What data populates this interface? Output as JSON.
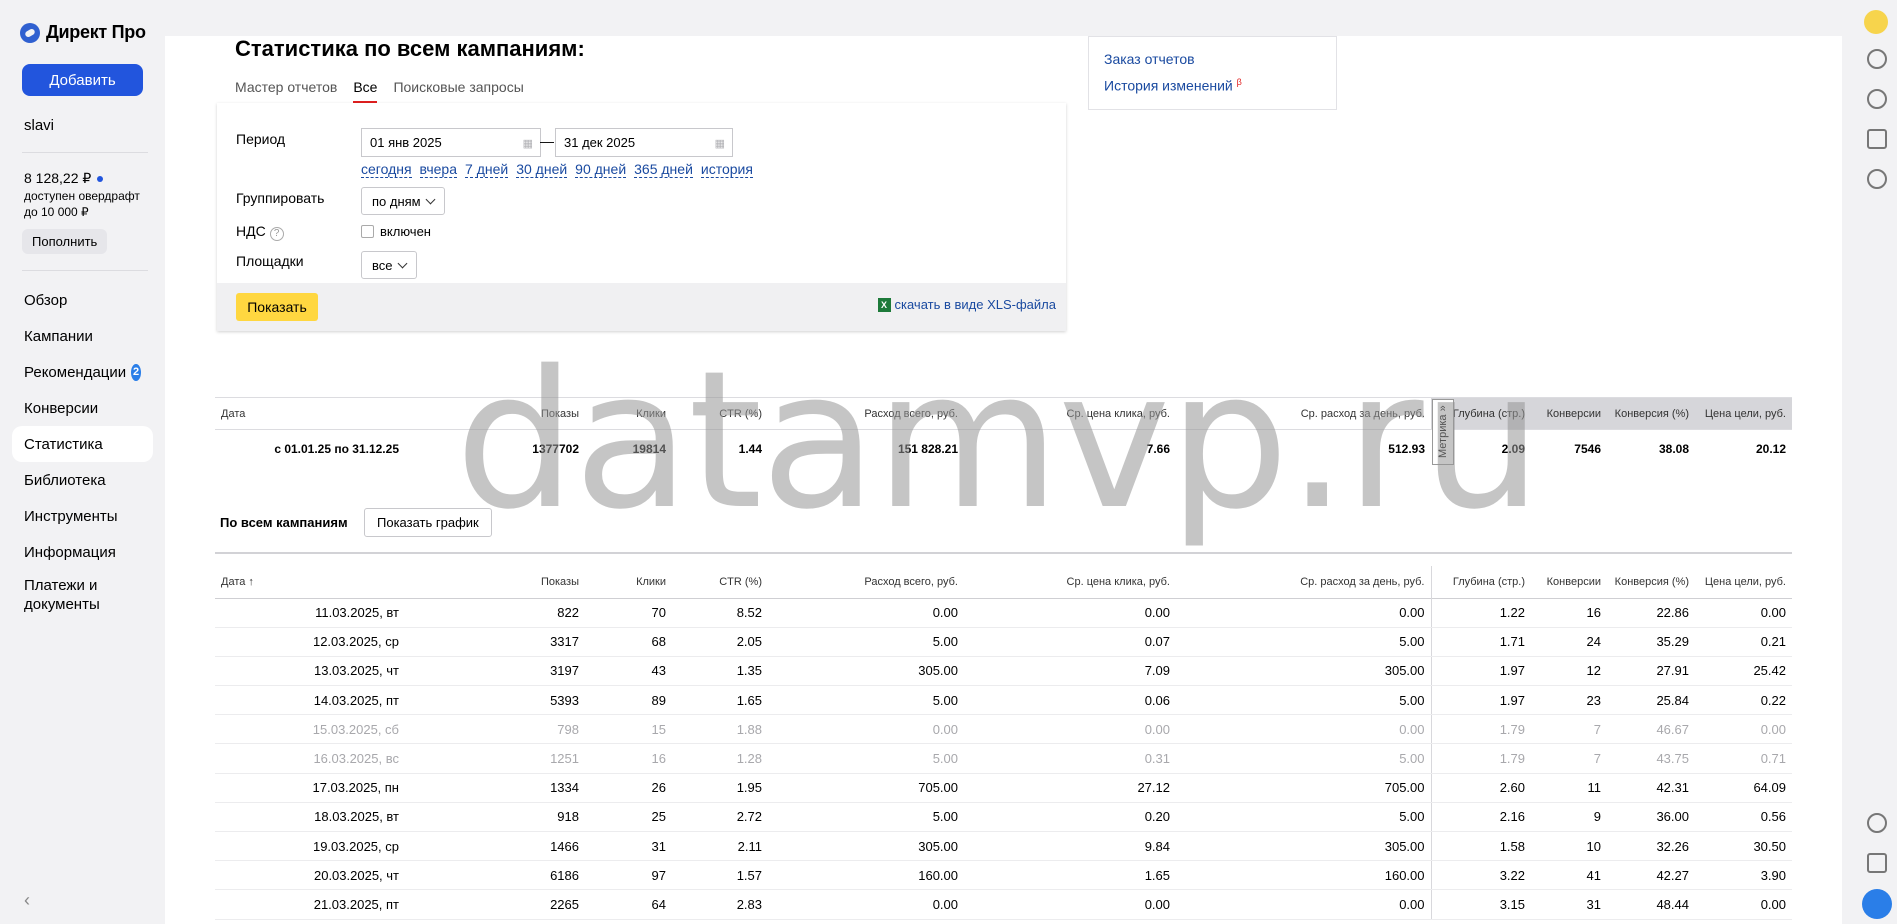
{
  "sidebar": {
    "logo_text": "Директ Про",
    "add_button": "Добавить",
    "user": "slavi",
    "balance": "8 128,22 ₽",
    "overdraft": "доступен овердрафт до 10 000 ₽",
    "topup": "Пополнить",
    "nav": [
      {
        "label": "Обзор"
      },
      {
        "label": "Кампании"
      },
      {
        "label": "Рекомендации",
        "badge": "2"
      },
      {
        "label": "Конверсии"
      },
      {
        "label": "Статистика",
        "active": true
      },
      {
        "label": "Библиотека"
      },
      {
        "label": "Инструменты"
      },
      {
        "label": "Информация"
      },
      {
        "label": "Платежи и документы"
      }
    ]
  },
  "header": {
    "title": "Статистика по всем кампаниям:",
    "tabs": [
      "Мастер отчетов",
      "Все",
      "Поисковые запросы"
    ],
    "active_tab": "Все"
  },
  "report_links": {
    "order": "Заказ отчетов",
    "history": "История изменений",
    "history_mark": "β"
  },
  "filters": {
    "period_label": "Период",
    "date_from": "01 янв 2025",
    "date_to": "31 дек 2025",
    "dash": "—",
    "quick": [
      "сегодня",
      "вчера",
      "7 дней",
      "30 дней",
      "90 дней",
      "365 дней",
      "история"
    ],
    "group_label": "Группировать",
    "group_value": "по дням",
    "vat_label": "НДС",
    "vat_help": "?",
    "vat_check": "включен",
    "places_label": "Площадки",
    "places_value": "все",
    "show_button": "Показать",
    "xls_link": "скачать в виде XLS-файла",
    "xls_icon": "X"
  },
  "columns": [
    "Дата",
    "Показы",
    "Клики",
    "CTR (%)",
    "Расход всего, руб.",
    "Ср. цена клика, руб.",
    "Ср. расход за день, руб.",
    "Глубина (стр.)",
    "Конверсии",
    "Конверсия (%)",
    "Цена цели, руб."
  ],
  "daily_date_header": "Дата ↑",
  "summary": {
    "metrika": "Метрика »",
    "row": [
      "с 01.01.25 по 31.12.25",
      "1377702",
      "19814",
      "1.44",
      "151 828.21",
      "7.66",
      "512.93",
      "2.09",
      "7546",
      "38.08",
      "20.12"
    ]
  },
  "subsection": {
    "title": "По всем кампаниям",
    "graph_button": "Показать график"
  },
  "daily_rows": [
    {
      "cells": [
        "11.03.2025, вт",
        "822",
        "70",
        "8.52",
        "0.00",
        "0.00",
        "0.00",
        "1.22",
        "16",
        "22.86",
        "0.00"
      ]
    },
    {
      "cells": [
        "12.03.2025, ср",
        "3317",
        "68",
        "2.05",
        "5.00",
        "0.07",
        "5.00",
        "1.71",
        "24",
        "35.29",
        "0.21"
      ]
    },
    {
      "cells": [
        "13.03.2025, чт",
        "3197",
        "43",
        "1.35",
        "305.00",
        "7.09",
        "305.00",
        "1.97",
        "12",
        "27.91",
        "25.42"
      ]
    },
    {
      "cells": [
        "14.03.2025, пт",
        "5393",
        "89",
        "1.65",
        "5.00",
        "0.06",
        "5.00",
        "1.97",
        "23",
        "25.84",
        "0.22"
      ]
    },
    {
      "cells": [
        "15.03.2025, сб",
        "798",
        "15",
        "1.88",
        "0.00",
        "0.00",
        "0.00",
        "1.79",
        "7",
        "46.67",
        "0.00"
      ],
      "weekend": true
    },
    {
      "cells": [
        "16.03.2025, вс",
        "1251",
        "16",
        "1.28",
        "5.00",
        "0.31",
        "5.00",
        "1.79",
        "7",
        "43.75",
        "0.71"
      ],
      "weekend": true
    },
    {
      "cells": [
        "17.03.2025, пн",
        "1334",
        "26",
        "1.95",
        "705.00",
        "27.12",
        "705.00",
        "2.60",
        "11",
        "42.31",
        "64.09"
      ]
    },
    {
      "cells": [
        "18.03.2025, вт",
        "918",
        "25",
        "2.72",
        "5.00",
        "0.20",
        "5.00",
        "2.16",
        "9",
        "36.00",
        "0.56"
      ]
    },
    {
      "cells": [
        "19.03.2025, ср",
        "1466",
        "31",
        "2.11",
        "305.00",
        "9.84",
        "305.00",
        "1.58",
        "10",
        "32.26",
        "30.50"
      ]
    },
    {
      "cells": [
        "20.03.2025, чт",
        "6186",
        "97",
        "1.57",
        "160.00",
        "1.65",
        "160.00",
        "3.22",
        "41",
        "42.27",
        "3.90"
      ]
    },
    {
      "cells": [
        "21.03.2025, пт",
        "2265",
        "64",
        "2.83",
        "0.00",
        "0.00",
        "0.00",
        "3.15",
        "31",
        "48.44",
        "0.00"
      ]
    }
  ],
  "watermark": "datamvp.ru",
  "colors": {
    "accent": "#2255dd",
    "show_button": "#ffd740",
    "link": "#1a4aa0"
  }
}
